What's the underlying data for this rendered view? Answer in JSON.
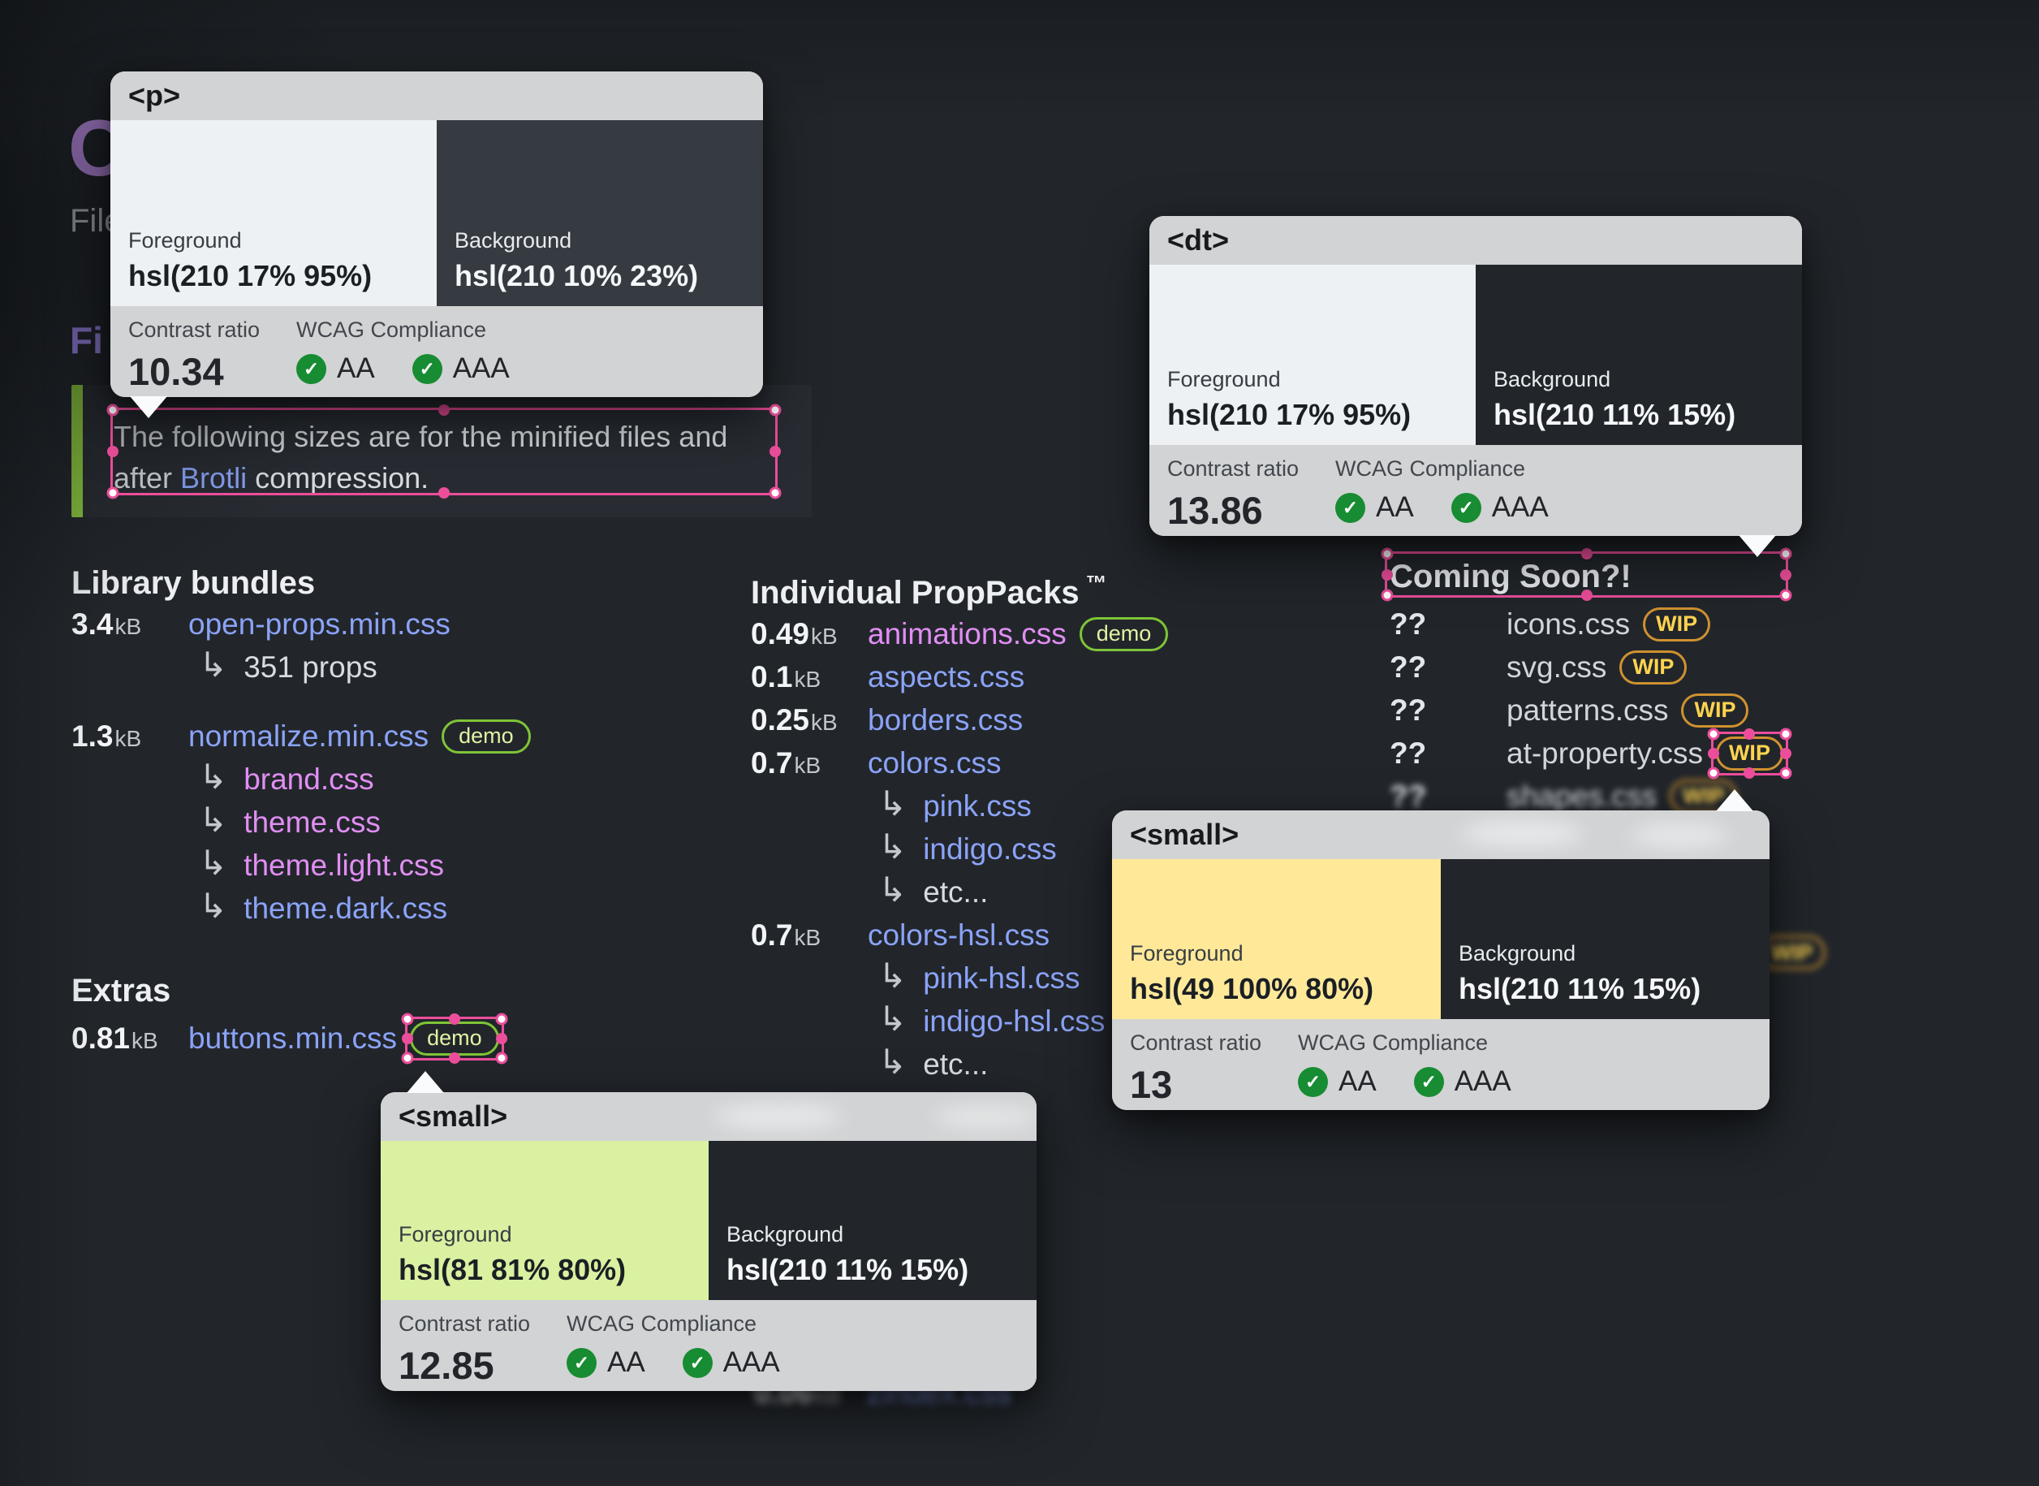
{
  "glyphs": {
    "sub_arrow": "↳",
    "check": "✓",
    "question": "??"
  },
  "colors": {
    "page_bg": "#22262b",
    "accent_selection_pink": "#ec4e9b",
    "link_blue": "#8ba3f7",
    "link_pink": "#e18ef3",
    "demo_pill_green": "#7fc437",
    "wip_pill_orange": "#cf9130",
    "check_green": "#178c32",
    "note_accent_green": "#8ac43e",
    "heading_purple": "#a18af0",
    "logo_purple": "#c795f2"
  },
  "page": {
    "logo_fragment": "O",
    "intro_fragment": "File",
    "section_heading_fragment": "Fi",
    "note": {
      "line1": "The following sizes are for the minified files and",
      "line2_pre": "after ",
      "link": "Brotli",
      "line2_post": " compression."
    }
  },
  "library": {
    "heading": "Library bundles",
    "items": [
      {
        "size": "3.4",
        "unit": "kB",
        "name": "open-props.min.css"
      },
      {
        "sub": "351 props"
      },
      {
        "size": "1.3",
        "unit": "kB",
        "name": "normalize.min.css",
        "badge": "demo"
      },
      {
        "sub": "brand.css"
      },
      {
        "sub": "theme.css"
      },
      {
        "sub": "theme.light.css"
      },
      {
        "sub": "theme.dark.css"
      }
    ]
  },
  "extras": {
    "heading": "Extras",
    "item": {
      "size": "0.81",
      "unit": "kB",
      "name": "buttons.min.css",
      "badge": "demo"
    }
  },
  "proppacks": {
    "heading": "Individual PropPacks",
    "tm": "™",
    "items": [
      {
        "size": "0.49",
        "unit": "kB",
        "name": "animations.css",
        "badge": "demo"
      },
      {
        "size": "0.1",
        "unit": "kB",
        "name": "aspects.css"
      },
      {
        "size": "0.25",
        "unit": "kB",
        "name": "borders.css"
      },
      {
        "size": "0.7",
        "unit": "kB",
        "name": "colors.css"
      },
      {
        "sub": "pink.css"
      },
      {
        "sub": "indigo.css"
      },
      {
        "sub": "etc..."
      },
      {
        "size": "0.7",
        "unit": "kB",
        "name": "colors-hsl.css"
      },
      {
        "sub": "pink-hsl.css"
      },
      {
        "sub": "indigo-hsl.css"
      },
      {
        "sub": "etc..."
      }
    ]
  },
  "coming_soon": {
    "heading": "Coming Soon?!",
    "items": [
      {
        "q": "??",
        "name": "icons.css",
        "badge": "WIP"
      },
      {
        "q": "??",
        "name": "svg.css",
        "badge": "WIP"
      },
      {
        "q": "??",
        "name": "patterns.css",
        "badge": "WIP"
      },
      {
        "q": "??",
        "name": "at-property.css",
        "badge": "WIP"
      },
      {
        "q": "??",
        "name": "shapes.css",
        "badge": "WIP"
      }
    ]
  },
  "blur_fragments": {
    "zindex": {
      "size": "0.06",
      "unit": "kB",
      "name": "zindex.css"
    },
    "wip_pill": "WIP"
  },
  "popups": [
    {
      "tag": "<p>",
      "fg_label": "Foreground",
      "fg_value": "hsl(210 17% 95%)",
      "bg_label": "Background",
      "bg_value": "hsl(210 10% 23%)",
      "ratio_label": "Contrast ratio",
      "ratio": "10.34",
      "wcag_label": "WCAG Compliance",
      "aa": "AA",
      "aaa": "AAA",
      "fg_hex": "#eef1f4",
      "bg_hex": "#353b41"
    },
    {
      "tag": "<dt>",
      "fg_label": "Foreground",
      "fg_value": "hsl(210 17% 95%)",
      "bg_label": "Background",
      "bg_value": "hsl(210 11% 15%)",
      "ratio_label": "Contrast ratio",
      "ratio": "13.86",
      "wcag_label": "WCAG Compliance",
      "aa": "AA",
      "aaa": "AAA",
      "fg_hex": "#eef1f4",
      "bg_hex": "#22262a"
    },
    {
      "tag": "<small>",
      "fg_label": "Foreground",
      "fg_value": "hsl(49 100% 80%)",
      "bg_label": "Background",
      "bg_value": "hsl(210 11% 15%)",
      "ratio_label": "Contrast ratio",
      "ratio": "13",
      "wcag_label": "WCAG Compliance",
      "aa": "AA",
      "aaa": "AAA",
      "fg_hex": "#ffe999",
      "bg_hex": "#22262a"
    },
    {
      "tag": "<small>",
      "fg_label": "Foreground",
      "fg_value": "hsl(81 81% 80%)",
      "bg_label": "Background",
      "bg_value": "hsl(210 11% 15%)",
      "ratio_label": "Contrast ratio",
      "ratio": "12.85",
      "wcag_label": "WCAG Compliance",
      "aa": "AA",
      "aaa": "AAA",
      "fg_hex": "#d9f1a1",
      "bg_hex": "#22262a"
    }
  ]
}
